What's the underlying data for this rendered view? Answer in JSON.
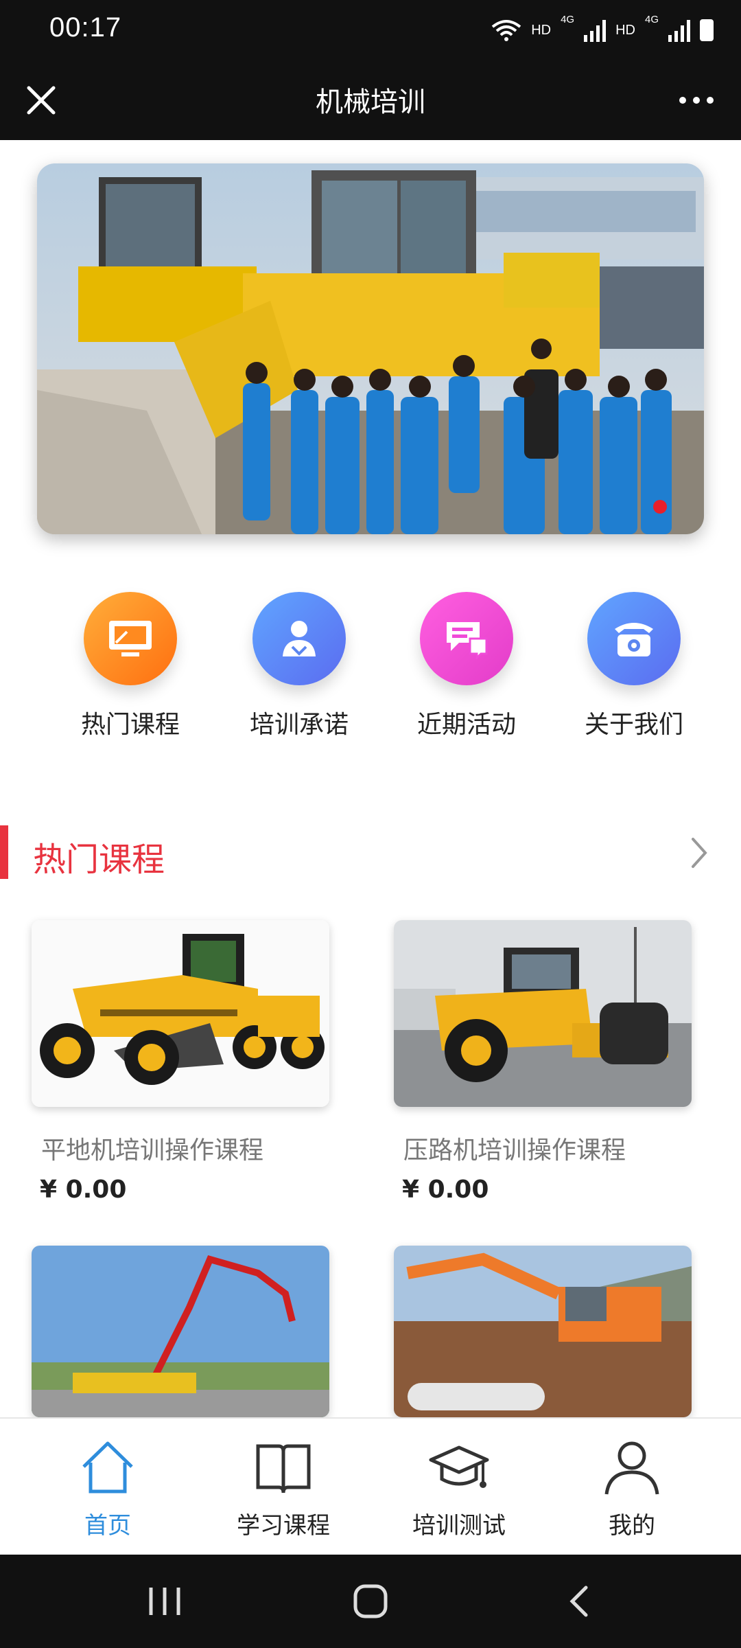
{
  "status_bar": {
    "time": "00:17",
    "network_1": "HD",
    "network_2": "4G",
    "network_3": "HD",
    "network_4": "4G"
  },
  "header": {
    "title": "机械培训",
    "close_icon": "close-icon",
    "more_icon": "more-icon"
  },
  "banner": {
    "slide_count": 1,
    "active_index": 0,
    "indicator_color": "#e81f2b"
  },
  "quick_menu": [
    {
      "label": "热门课程",
      "icon": "monitor-icon",
      "color": "#ff8a1f"
    },
    {
      "label": "培训承诺",
      "icon": "person-icon",
      "color": "#4f86f7"
    },
    {
      "label": "近期活动",
      "icon": "chat-icon",
      "color": "#f04bd8"
    },
    {
      "label": "关于我们",
      "icon": "phone-icon",
      "color": "#4f86f7"
    }
  ],
  "section": {
    "title": "热门课程",
    "accent": "#e8333f"
  },
  "courses": [
    {
      "name": "平地机培训操作课程",
      "price": "¥ 0.00"
    },
    {
      "name": "压路机培训操作课程",
      "price": "¥ 0.00"
    },
    {
      "name": "",
      "price": ""
    },
    {
      "name": "",
      "price": ""
    }
  ],
  "tab_bar": [
    {
      "label": "首页",
      "icon": "home-icon",
      "active": true
    },
    {
      "label": "学习课程",
      "icon": "book-icon",
      "active": false
    },
    {
      "label": "培训测试",
      "icon": "graduation-cap-icon",
      "active": false
    },
    {
      "label": "我的",
      "icon": "user-icon",
      "active": false
    }
  ],
  "colors": {
    "active_tab": "#2e8ddc",
    "header_bg": "#111111"
  }
}
